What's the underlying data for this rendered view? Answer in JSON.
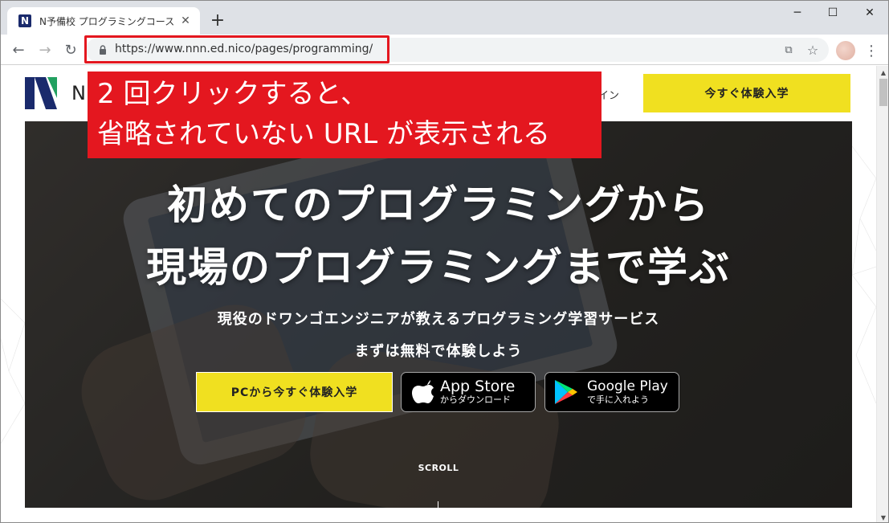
{
  "browser": {
    "tab": {
      "favicon": "N",
      "title": "N予備校 プログラミングコース",
      "close": "✕"
    },
    "newtab": "+",
    "window_controls": {
      "minimize": "─",
      "maximize": "☐",
      "close": "✕"
    },
    "nav": {
      "back": "←",
      "forward": "→",
      "reload": "↻"
    },
    "omnibox": {
      "url": "https://www.nnn.ed.nico/pages/programming/",
      "cast_icon": "⧉",
      "bookmark_icon": "☆"
    },
    "menu": "⋮"
  },
  "annotation": {
    "line1": "2 回クリックすると、",
    "line2": "省略されていない URL が表示される",
    "color": "#e4171f"
  },
  "site": {
    "logo_text": "N",
    "nav_tail": "イン",
    "cta_top": "今すぐ体験入学",
    "hero": {
      "title_line1": "初めてのプログラミングから",
      "title_line2": "現場のプログラミングまで学ぶ",
      "sub_line1": "現役のドワンゴエンジニアが教えるプログラミング学習サービス",
      "sub_line2": "まずは無料で体験しよう",
      "pc_button": "PCから今すぐ体験入学",
      "appstore_big": "App Store",
      "appstore_small": "からダウンロード",
      "googleplay_big": "Google Play",
      "googleplay_small": "で手に入れよう",
      "scroll": "SCROLL"
    }
  },
  "scrollbar": {
    "up": "▲",
    "down": "▼"
  },
  "colors": {
    "accent_yellow": "#f0e020",
    "logo_navy": "#1a2a6c",
    "logo_green": "#22a060"
  }
}
